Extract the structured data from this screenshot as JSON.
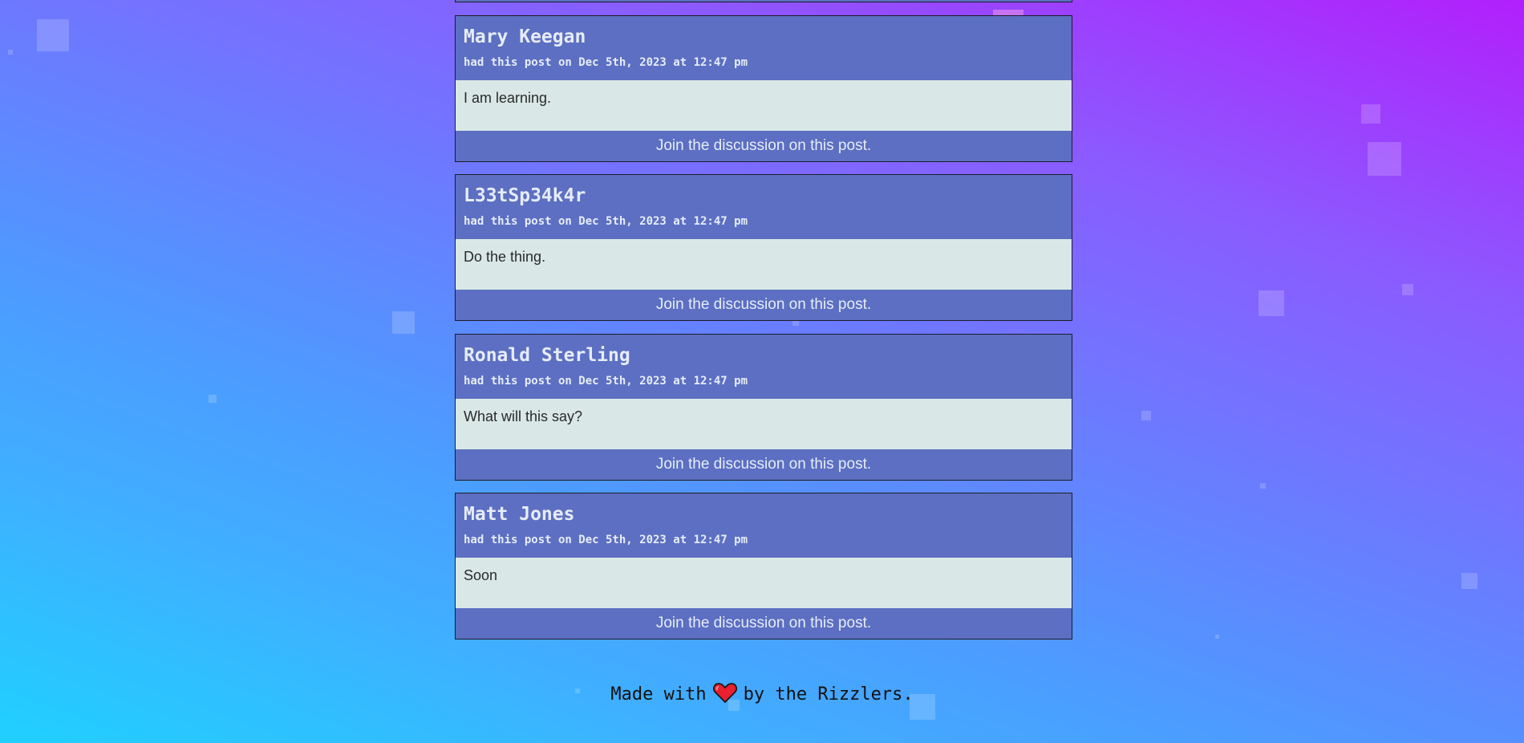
{
  "posts": [
    {
      "author": "Mary Keegan",
      "meta": "had this post on Dec 5th, 2023 at 12:47 pm",
      "body": "I am learning.",
      "cta": "Join the discussion on this post."
    },
    {
      "author": "L33tSp34k4r",
      "meta": "had this post on Dec 5th, 2023 at 12:47 pm",
      "body": "Do the thing.",
      "cta": "Join the discussion on this post."
    },
    {
      "author": "Ronald Sterling",
      "meta": "had this post on Dec 5th, 2023 at 12:47 pm",
      "body": "What will this say?",
      "cta": "Join the discussion on this post."
    },
    {
      "author": "Matt Jones",
      "meta": "had this post on Dec 5th, 2023 at 12:47 pm",
      "body": "Soon",
      "cta": "Join the discussion on this post."
    }
  ],
  "footer": {
    "before": "Made with",
    "icon": "heart-icon",
    "after": "by the Rizzlers."
  },
  "colors": {
    "card": "#5c6fc2",
    "card_body": "#d9e8e6",
    "heart": "#e8202f"
  }
}
